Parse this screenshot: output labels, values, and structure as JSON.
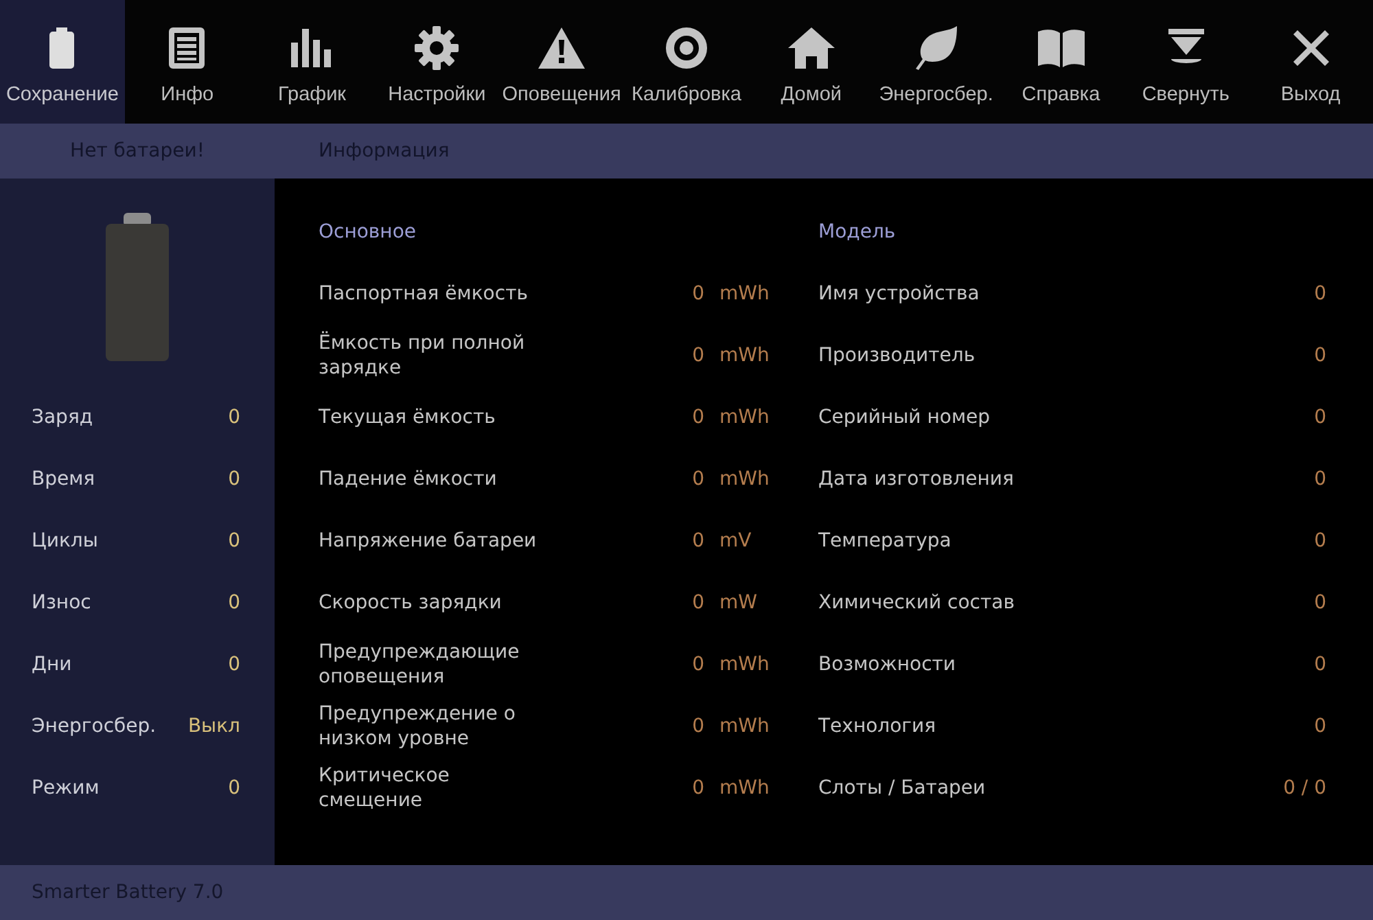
{
  "toolbar": [
    {
      "label": "Сохранение",
      "selected": true
    },
    {
      "label": "Инфо",
      "selected": false
    },
    {
      "label": "График",
      "selected": false
    },
    {
      "label": "Настройки",
      "selected": false
    },
    {
      "label": "Оповещения",
      "selected": false
    },
    {
      "label": "Калибровка",
      "selected": false
    },
    {
      "label": "Домой",
      "selected": false
    },
    {
      "label": "Энергосбер.",
      "selected": false
    },
    {
      "label": "Справка",
      "selected": false
    },
    {
      "label": "Свернуть",
      "selected": false
    },
    {
      "label": "Выход",
      "selected": false
    }
  ],
  "subheader": {
    "battery_status": "Нет батареи!",
    "section_title": "Информация"
  },
  "sidebar": {
    "stats": [
      {
        "label": "Заряд",
        "value": "0"
      },
      {
        "label": "Время",
        "value": "0"
      },
      {
        "label": "Циклы",
        "value": "0"
      },
      {
        "label": "Износ",
        "value": "0"
      },
      {
        "label": "Дни",
        "value": "0"
      },
      {
        "label": "Энергосбер.",
        "value": "Выкл"
      },
      {
        "label": "Режим",
        "value": "0"
      }
    ]
  },
  "info": {
    "columns": [
      {
        "title": "Основное",
        "rows": [
          {
            "label": "Паспортная ёмкость",
            "value": "0",
            "unit": "mWh"
          },
          {
            "label": "Ёмкость при полной зарядке",
            "value": "0",
            "unit": "mWh"
          },
          {
            "label": "Текущая ёмкость",
            "value": "0",
            "unit": "mWh"
          },
          {
            "label": "Падение ёмкости",
            "value": "0",
            "unit": "mWh"
          },
          {
            "label": "Напряжение батареи",
            "value": "0",
            "unit": "mV"
          },
          {
            "label": "Скорость зарядки",
            "value": "0",
            "unit": "mW"
          },
          {
            "label": "Предупреждающие оповещения",
            "value": "0",
            "unit": "mWh"
          },
          {
            "label": "Предупреждение о низком уровне",
            "value": "0",
            "unit": "mWh"
          },
          {
            "label": "Критическое смещение",
            "value": "0",
            "unit": "mWh"
          }
        ]
      },
      {
        "title": "Модель",
        "rows": [
          {
            "label": "Имя устройства",
            "value": "0"
          },
          {
            "label": "Производитель",
            "value": "0"
          },
          {
            "label": "Серийный номер",
            "value": "0"
          },
          {
            "label": "Дата изготовления",
            "value": "0"
          },
          {
            "label": "Температура",
            "value": "0"
          },
          {
            "label": "Химический состав",
            "value": "0"
          },
          {
            "label": "Возможности",
            "value": "0"
          },
          {
            "label": "Технология",
            "value": "0"
          },
          {
            "label": "Слоты / Батареи",
            "value": "0 / 0"
          }
        ]
      }
    ]
  },
  "status_bar": {
    "app_name": "Smarter Battery 7.0"
  }
}
